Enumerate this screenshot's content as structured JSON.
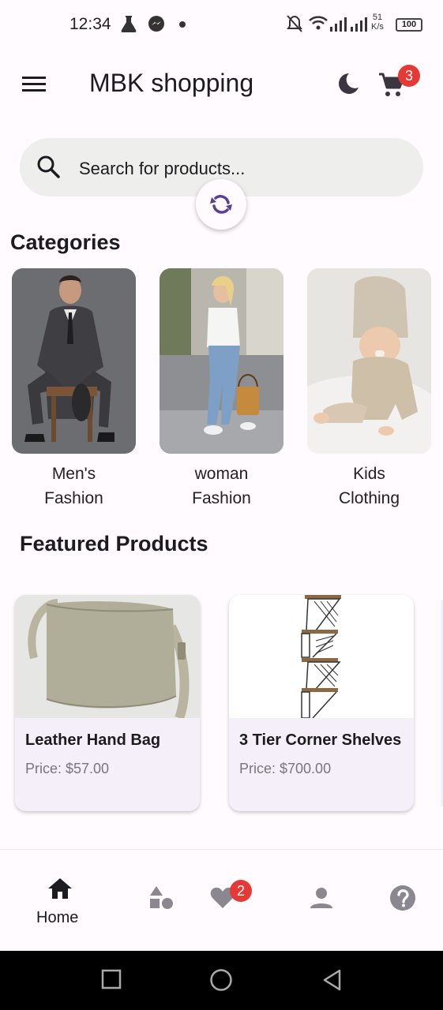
{
  "status_bar": {
    "time": "12:34",
    "net_speed_value": "51",
    "net_speed_unit": "K/s",
    "battery": "100"
  },
  "app_bar": {
    "title": "MBK shopping",
    "cart_count": "3"
  },
  "search": {
    "placeholder": "Search for products..."
  },
  "categories": {
    "title": "Categories",
    "items": [
      {
        "line1": "Men's",
        "line2": "Fashion"
      },
      {
        "line1": "woman",
        "line2": "Fashion"
      },
      {
        "line1": "Kids",
        "line2": "Clothing"
      }
    ]
  },
  "featured": {
    "title": "Featured Products",
    "items": [
      {
        "name": "Leather Hand Bag",
        "price": "Price: $57.00"
      },
      {
        "name": "3 Tier Corner Shelves",
        "price": "Price: $700.00"
      }
    ]
  },
  "bottom_nav": {
    "home_label": "Home",
    "wishlist_count": "2",
    "items": [
      "home-icon",
      "categories-icon",
      "heart-icon",
      "person-icon",
      "help-icon"
    ]
  },
  "colors": {
    "accent": "#5b3e96",
    "badge": "#e53935",
    "surface": "#fffbfe",
    "card": "#f4eff8"
  }
}
